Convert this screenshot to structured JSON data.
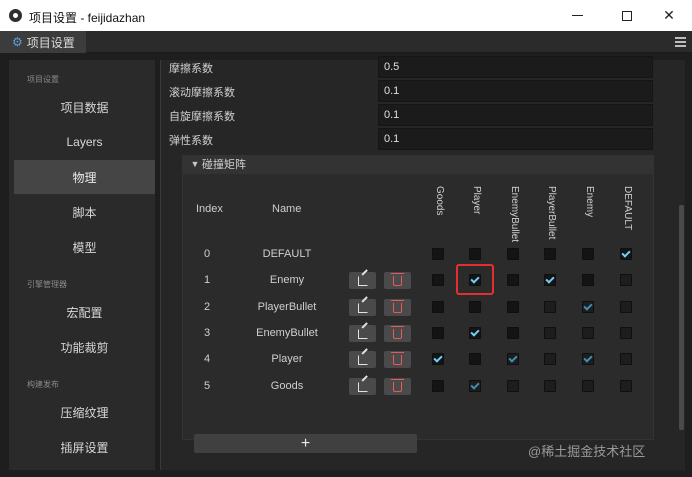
{
  "window": {
    "title": "项目设置 - feijidazhan",
    "close_glyph": "✕"
  },
  "tab": {
    "label": "项目设置",
    "icon": "gear-icon"
  },
  "sidebar": {
    "sections": [
      "项目设置",
      "引擎管理器",
      "构建发布"
    ],
    "items": [
      {
        "label": "项目数据",
        "active": false
      },
      {
        "label": "Layers",
        "active": false
      },
      {
        "label": "物理",
        "active": true
      },
      {
        "label": "脚本",
        "active": false
      },
      {
        "label": "模型",
        "active": false
      },
      {
        "label": "宏配置",
        "active": false
      },
      {
        "label": "功能裁剪",
        "active": false
      },
      {
        "label": "压缩纹理",
        "active": false
      },
      {
        "label": "插屏设置",
        "active": false
      }
    ]
  },
  "properties": [
    {
      "label": "摩擦系数",
      "value": "0.5"
    },
    {
      "label": "滚动摩擦系数",
      "value": "0.1"
    },
    {
      "label": "自旋摩擦系数",
      "value": "0.1"
    },
    {
      "label": "弹性系数",
      "value": "0.1"
    }
  ],
  "collision_matrix": {
    "title": "碰撞矩阵",
    "index_header": "Index",
    "name_header": "Name",
    "columns": [
      "Goods",
      "Player",
      "EnemyBullet",
      "PlayerBullet",
      "Enemy",
      "DEFAULT"
    ],
    "rows": [
      {
        "index": "0",
        "name": "DEFAULT",
        "editable": false,
        "checks": [
          {
            "v": false,
            "dim": false
          },
          {
            "v": false,
            "dim": false
          },
          {
            "v": false,
            "dim": false
          },
          {
            "v": false,
            "dim": false
          },
          {
            "v": false,
            "dim": false
          },
          {
            "v": true,
            "dim": false
          }
        ]
      },
      {
        "index": "1",
        "name": "Enemy",
        "editable": true,
        "checks": [
          {
            "v": false,
            "dim": false
          },
          {
            "v": true,
            "dim": false
          },
          {
            "v": false,
            "dim": false
          },
          {
            "v": true,
            "dim": false
          },
          {
            "v": false,
            "dim": false
          },
          {
            "v": false,
            "dim": true
          }
        ]
      },
      {
        "index": "2",
        "name": "PlayerBullet",
        "editable": true,
        "checks": [
          {
            "v": false,
            "dim": false
          },
          {
            "v": false,
            "dim": false
          },
          {
            "v": false,
            "dim": false
          },
          {
            "v": false,
            "dim": true
          },
          {
            "v": true,
            "dim": true
          },
          {
            "v": false,
            "dim": true
          }
        ]
      },
      {
        "index": "3",
        "name": "EnemyBullet",
        "editable": true,
        "checks": [
          {
            "v": false,
            "dim": false
          },
          {
            "v": true,
            "dim": false
          },
          {
            "v": false,
            "dim": false
          },
          {
            "v": false,
            "dim": true
          },
          {
            "v": false,
            "dim": true
          },
          {
            "v": false,
            "dim": true
          }
        ]
      },
      {
        "index": "4",
        "name": "Player",
        "editable": true,
        "checks": [
          {
            "v": true,
            "dim": false
          },
          {
            "v": false,
            "dim": false
          },
          {
            "v": true,
            "dim": true
          },
          {
            "v": false,
            "dim": true
          },
          {
            "v": true,
            "dim": true
          },
          {
            "v": false,
            "dim": true
          }
        ]
      },
      {
        "index": "5",
        "name": "Goods",
        "editable": true,
        "checks": [
          {
            "v": false,
            "dim": false
          },
          {
            "v": true,
            "dim": true
          },
          {
            "v": false,
            "dim": true
          },
          {
            "v": false,
            "dim": true
          },
          {
            "v": false,
            "dim": true
          },
          {
            "v": false,
            "dim": true
          }
        ]
      }
    ],
    "highlight": {
      "row": 1,
      "col": 1,
      "color": "#e52f2f"
    },
    "add_label": "+"
  },
  "watermark": "@稀土掘金技术社区",
  "colors": {
    "accent": "#6fd0ff",
    "highlight": "#e52f2f",
    "delete": "#e35b5b"
  }
}
